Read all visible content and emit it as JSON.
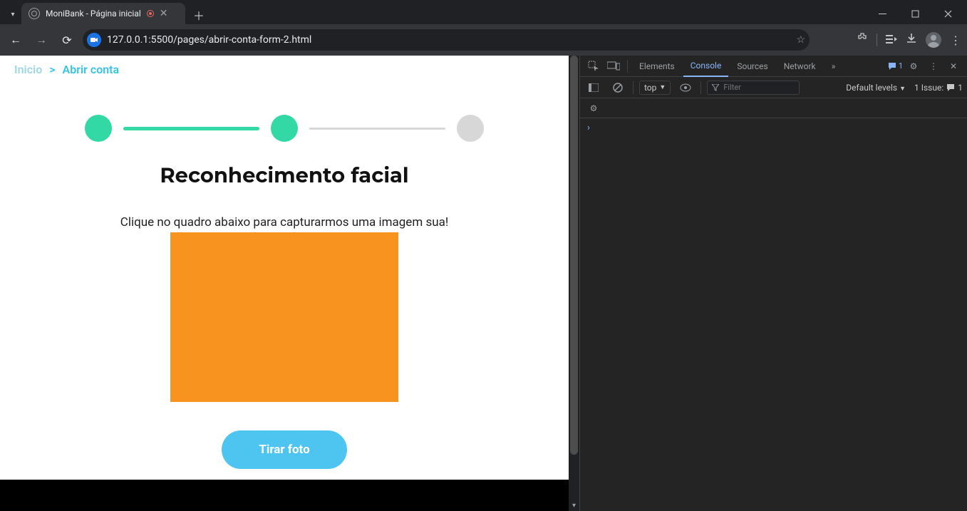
{
  "browser": {
    "tab": {
      "title": "MoniBank - Página inicial"
    },
    "url": "127.0.0.1:5500/pages/abrir-conta-form-2.html"
  },
  "page": {
    "breadcrumb": {
      "home": "Inicio",
      "sep": ">",
      "current": "Abrir conta"
    },
    "heading": "Reconhecimento facial",
    "hint": "Clique no quadro abaixo para capturarmos uma imagem sua!",
    "cta": "Tirar foto"
  },
  "devtools": {
    "tabs": {
      "elements": "Elements",
      "console": "Console",
      "sources": "Sources",
      "network": "Network"
    },
    "msg_count": "1",
    "context": "top",
    "filter_placeholder": "Filter",
    "levels": "Default levels",
    "issues_label": "1 Issue:",
    "issues_count": "1"
  }
}
